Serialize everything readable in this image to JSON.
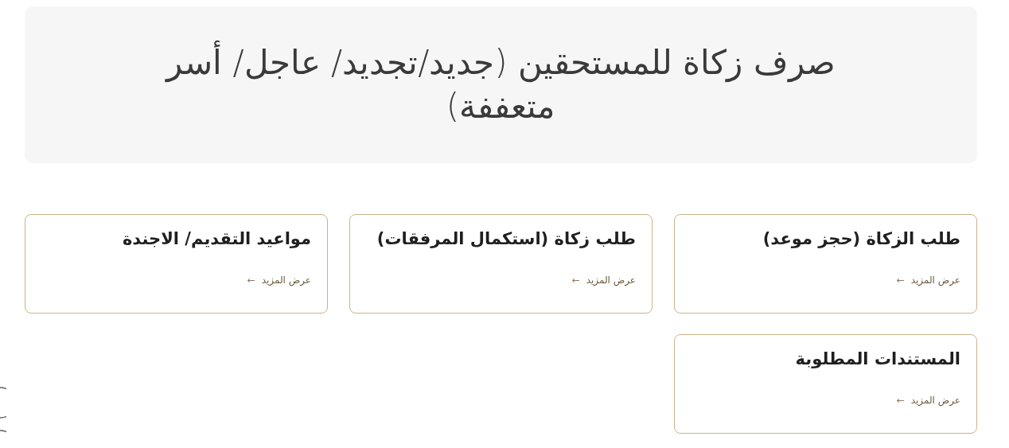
{
  "header": {
    "title": "صرف زكاة للمستحقين (جديد/تجديد/ عاجل/ أسر متعففة)"
  },
  "cards": [
    {
      "title": "طلب الزكاة (حجز موعد)",
      "link": "عرض المزيد",
      "arrow": "←"
    },
    {
      "title": "طلب زكاة (استكمال المرفقات)",
      "link": "عرض المزيد",
      "arrow": "←"
    },
    {
      "title": "مواعيد التقديم/ الاجندة",
      "link": "عرض المزيد",
      "arrow": "←"
    },
    {
      "title": "المستندات المطلوبة",
      "link": "عرض المزيد",
      "arrow": "←"
    }
  ]
}
